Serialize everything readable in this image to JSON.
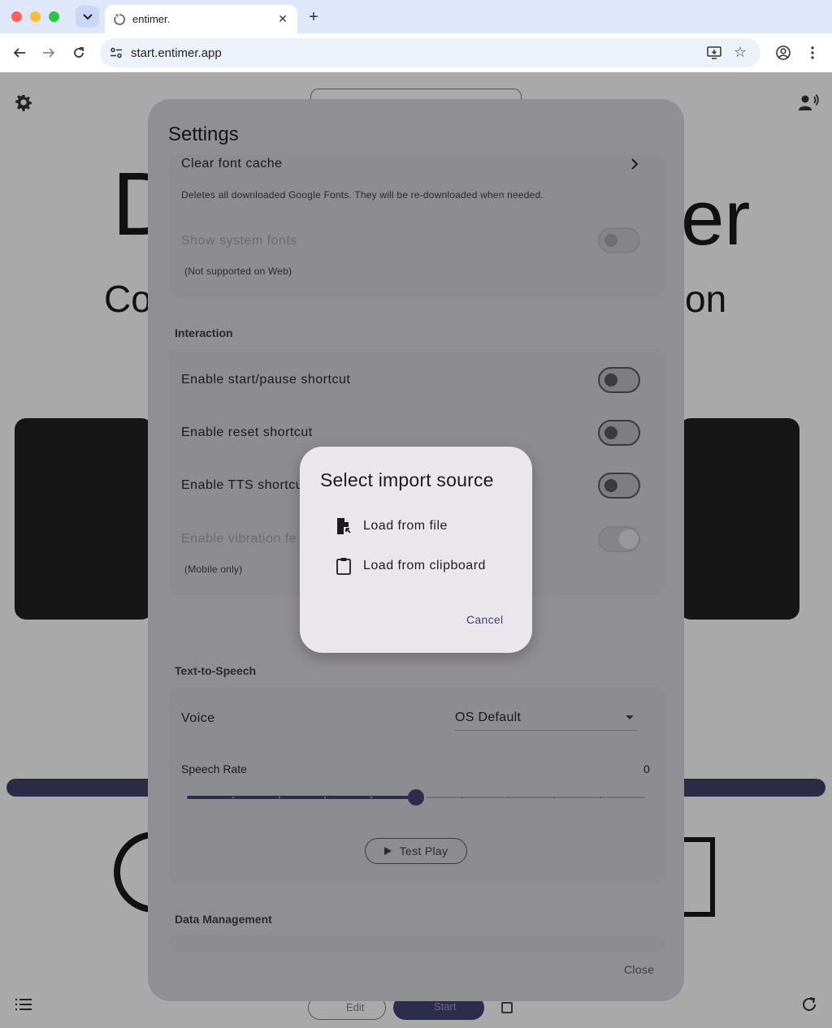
{
  "browser": {
    "tab_title": "entimer.",
    "url": "start.entimer.app",
    "new_tab_label": "+",
    "tab_close_label": "✕"
  },
  "background": {
    "title_left": "D",
    "title_right": "er",
    "subtitle_left": "Co",
    "subtitle_right": "on",
    "bottom_edit_label": "Edit",
    "bottom_start_label": "Start"
  },
  "settings": {
    "title": "Settings",
    "fonts": {
      "clear_cache_label": "Clear font cache",
      "clear_cache_desc": "Deletes all downloaded Google Fonts. They will be re-downloaded when needed.",
      "show_system_fonts_label": "Show system fonts",
      "show_system_fonts_note": "(Not supported on Web)"
    },
    "interaction": {
      "heading": "Interaction",
      "start_pause_label": "Enable start/pause shortcut",
      "reset_label": "Enable reset shortcut",
      "tts_label": "Enable TTS shortcu",
      "vibration_label": "Enable vibration fe",
      "vibration_note": "(Mobile only)"
    },
    "tts": {
      "heading": "Text-to-Speech",
      "voice_label": "Voice",
      "voice_value": "OS Default",
      "speech_rate_label": "Speech Rate",
      "speech_rate_value": "0",
      "speech_rate_fraction": 0.5,
      "test_play_label": "Test Play"
    },
    "data_management": {
      "heading": "Data Management"
    },
    "close_label": "Close"
  },
  "import_dialog": {
    "title": "Select import source",
    "options": [
      {
        "label": "Load from file",
        "icon": "file-import-icon"
      },
      {
        "label": "Load from clipboard",
        "icon": "clipboard-icon"
      }
    ],
    "cancel_label": "Cancel"
  },
  "colors": {
    "accent": "#2c2c4d",
    "dialog_bg": "#eae7ec",
    "cancel_text": "#3d3f7a"
  }
}
